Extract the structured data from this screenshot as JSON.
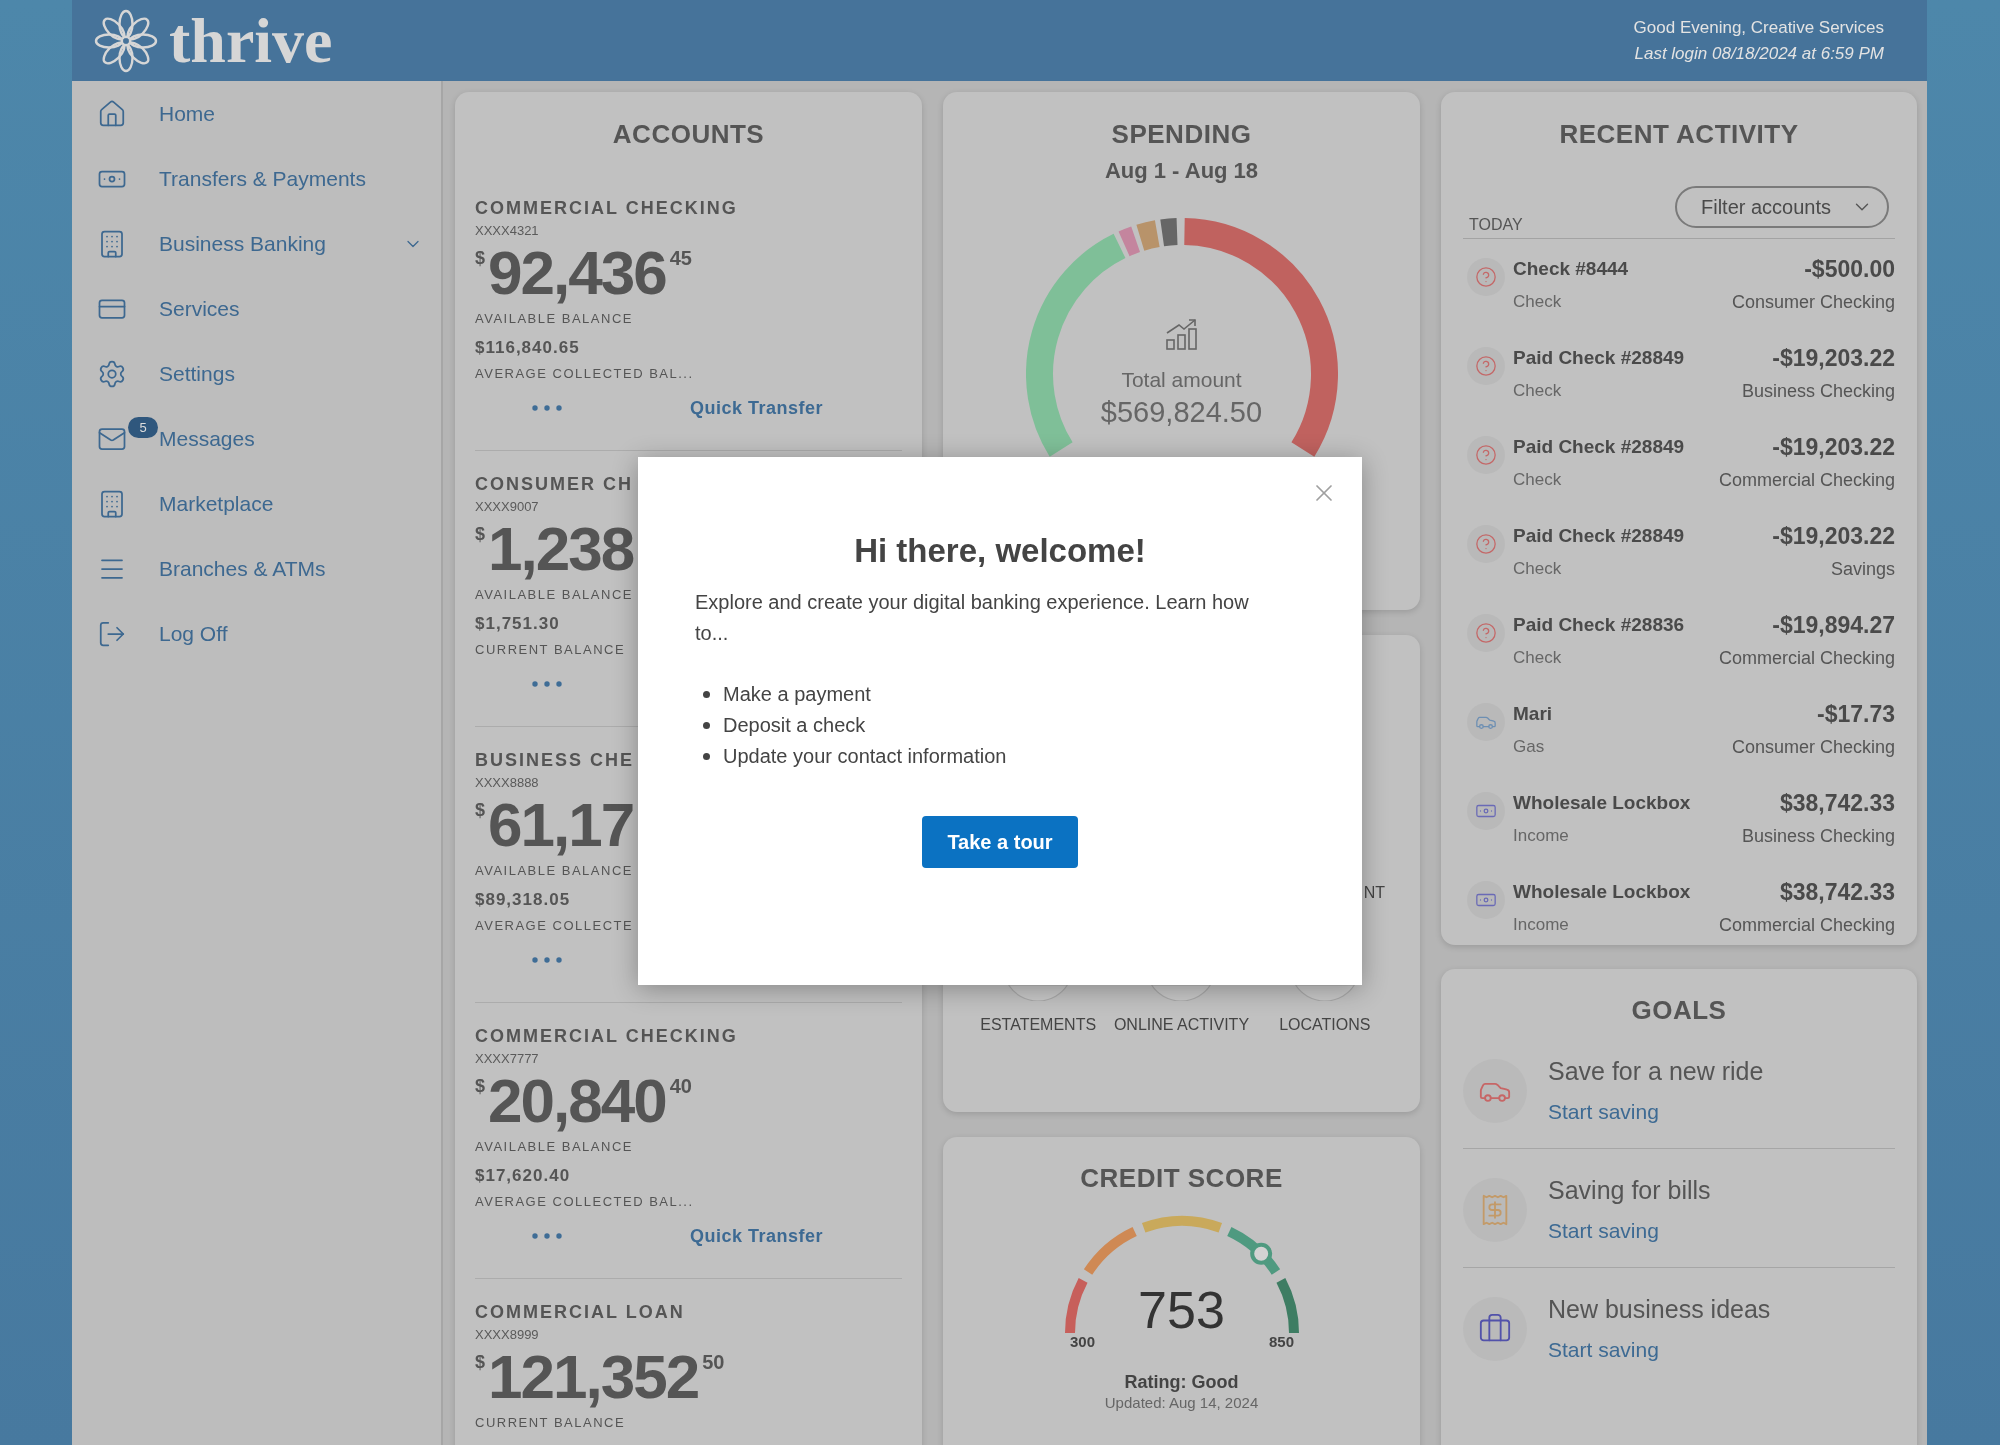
{
  "header": {
    "logo": "thrive",
    "greeting": "Good Evening, Creative Services",
    "last_login": "Last login 08/18/2024 at 6:59 PM"
  },
  "sidebar": {
    "items": [
      {
        "kind": "home",
        "label": "Home",
        "expandable": false
      },
      {
        "kind": "bill",
        "label": "Transfers & Payments",
        "expandable": false
      },
      {
        "kind": "building",
        "label": "Business Banking",
        "expandable": true
      },
      {
        "kind": "card",
        "label": "Services",
        "expandable": false
      },
      {
        "kind": "gear",
        "label": "Settings",
        "expandable": false
      },
      {
        "kind": "mail",
        "label": "Messages",
        "badge": "5",
        "expandable": false
      },
      {
        "kind": "building",
        "label": "Marketplace",
        "expandable": false
      },
      {
        "kind": "lines",
        "label": "Branches & ATMs",
        "expandable": false
      },
      {
        "kind": "logout",
        "label": "Log Off",
        "expandable": false
      }
    ]
  },
  "accounts": {
    "title": "ACCOUNTS",
    "items": [
      {
        "name": "COMMERCIAL CHECKING",
        "number": "XXXX4321",
        "currency": "$",
        "whole": "92,436",
        "cents": "45",
        "balance_label": "AVAILABLE BALANCE",
        "second_amount": "$116,840.65",
        "second_label": "AVERAGE COLLECTED BAL...",
        "action": "Quick Transfer"
      },
      {
        "name": "CONSUMER CH",
        "number": "XXXX9007",
        "currency": "$",
        "whole": "1,238",
        "balance_label": "AVAILABLE BALANCE",
        "second_amount": "$1,751.30",
        "second_label": "CURRENT BALANCE"
      },
      {
        "name": "BUSINESS CHE",
        "number": "XXXX8888",
        "currency": "$",
        "whole": "61,17",
        "balance_label": "AVAILABLE BALANCE",
        "second_amount": "$89,318.05",
        "second_label": "AVERAGE COLLECTE"
      },
      {
        "name": "COMMERCIAL CHECKING",
        "number": "XXXX7777",
        "currency": "$",
        "whole": "20,840",
        "cents": "40",
        "balance_label": "AVAILABLE BALANCE",
        "second_amount": "$17,620.40",
        "second_label": "AVERAGE COLLECTED BAL...",
        "action": "Quick Transfer"
      },
      {
        "name": "COMMERCIAL LOAN",
        "number": "XXXX8999",
        "currency": "$",
        "whole": "121,352",
        "cents": "50",
        "balance_label": "CURRENT BALANCE"
      }
    ]
  },
  "spending": {
    "title": "SPENDING",
    "period": "Aug 1 - Aug 18",
    "total_label": "Total amount",
    "total": "$569,824.50"
  },
  "quick_links": {
    "text_1": "NT",
    "links": [
      "ESTATEMENTS",
      "ONLINE ACTIVITY",
      "LOCATIONS"
    ]
  },
  "credit_score": {
    "title": "CREDIT SCORE",
    "score": "753",
    "min": "300",
    "max": "850",
    "level": 0.75,
    "rating": "Rating: Good",
    "updated": "Updated: Aug 14, 2024"
  },
  "recent_activity": {
    "title": "RECENT ACTIVITY",
    "filter": {
      "label": "Filter accounts"
    },
    "section": "TODAY",
    "items": [
      {
        "kind": "check",
        "name": "Check #8444",
        "category": "Check",
        "amount": "-$500.00",
        "account": "Consumer Checking"
      },
      {
        "kind": "check",
        "name": "Paid Check #28849",
        "category": "Check",
        "amount": "-$19,203.22",
        "account": "Business Checking"
      },
      {
        "kind": "check",
        "name": "Paid Check #28849",
        "category": "Check",
        "amount": "-$19,203.22",
        "account": "Commercial Checking"
      },
      {
        "kind": "check",
        "name": "Paid Check #28849",
        "category": "Check",
        "amount": "-$19,203.22",
        "account": "Savings"
      },
      {
        "kind": "check",
        "name": "Paid Check #28836",
        "category": "Check",
        "amount": "-$19,894.27",
        "account": "Commercial Checking"
      },
      {
        "kind": "car",
        "name": "Mari",
        "category": "Gas",
        "amount": "-$17.73",
        "account": "Consumer Checking"
      },
      {
        "kind": "cash",
        "name": "Wholesale Lockbox",
        "category": "Income",
        "amount": "$38,742.33",
        "account": "Business Checking"
      },
      {
        "kind": "cash",
        "name": "Wholesale Lockbox",
        "category": "Income",
        "amount": "$38,742.33",
        "account": "Commercial Checking"
      }
    ]
  },
  "goals": {
    "title": "GOALS",
    "items": [
      {
        "kind": "car",
        "title": "Save for a new ride",
        "action": "Start saving"
      },
      {
        "kind": "bill",
        "title": "Saving for bills",
        "action": "Start saving"
      },
      {
        "kind": "briefcase",
        "title": "New business ideas",
        "action": "Start saving"
      }
    ]
  },
  "dialog": {
    "title": "Hi there, welcome!",
    "text": "Explore and create your digital banking experience. Learn how to...",
    "bullets": [
      "Make a payment",
      "Deposit a check",
      "Update your contact information"
    ],
    "button": "Take a tour"
  }
}
